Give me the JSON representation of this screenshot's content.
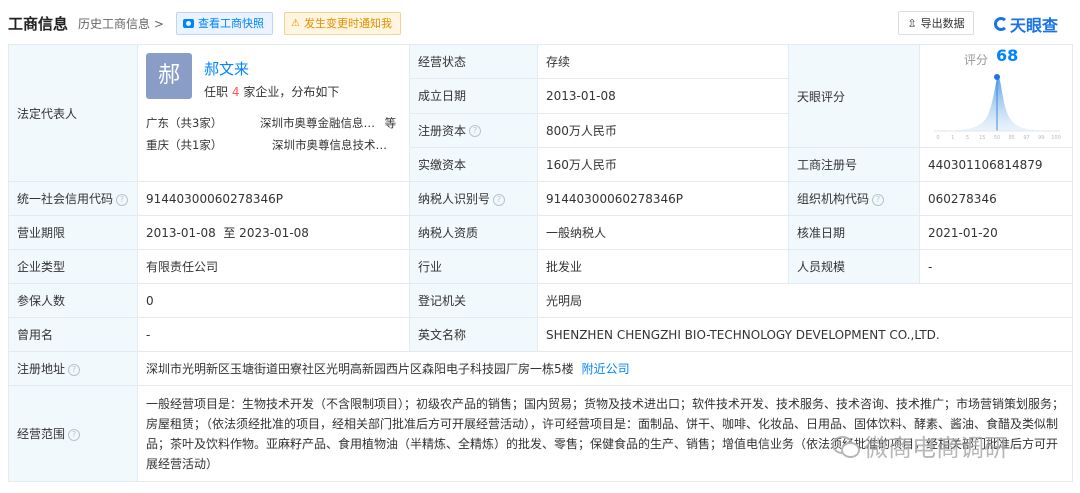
{
  "topbar": {
    "title": "工商信息",
    "history": "历史工商信息 >",
    "snapshot": "查看工商快照",
    "notify": "发生变更时通知我",
    "export": "导出数据",
    "brand": "天眼查"
  },
  "rep": {
    "label": "法定代表人",
    "avatar": "郝",
    "name": "郝文来",
    "sub_pre": "任职",
    "count": "4",
    "sub_post": "家企业，分布如下",
    "reg1_prov": "广东（共3家）",
    "reg1_co": "深圳市奥尊金融信息…",
    "reg1_more": "等",
    "reg2_prov": "重庆（共1家）",
    "reg2_co": "深圳市奥尊信息技术…"
  },
  "score": {
    "label": "天眼评分",
    "text": "评分",
    "value": "68",
    "ticks": [
      "0",
      "1",
      "5",
      "15",
      "50",
      "85",
      "97",
      "99",
      "100"
    ]
  },
  "rows": {
    "status_l": "经营状态",
    "status_v": "存续",
    "found_l": "成立日期",
    "found_v": "2013-01-08",
    "capital_l": "注册资本",
    "capital_v": "800万人民币",
    "paid_l": "实缴资本",
    "paid_v": "160万人民币",
    "regno_l": "工商注册号",
    "regno_v": "440301106814879",
    "credit_l": "统一社会信用代码",
    "credit_v": "91440300060278346P",
    "taxid_l": "纳税人识别号",
    "taxid_v": "91440300060278346P",
    "org_l": "组织机构代码",
    "org_v": "060278346",
    "term_l": "营业期限",
    "term_v": "2013-01-08  至 2023-01-08",
    "taxq_l": "纳税人资质",
    "taxq_v": "一般纳税人",
    "approve_l": "核准日期",
    "approve_v": "2021-01-20",
    "type_l": "企业类型",
    "type_v": "有限责任公司",
    "industry_l": "行业",
    "industry_v": "批发业",
    "staff_l": "人员规模",
    "staff_v": "-",
    "insured_l": "参保人数",
    "insured_v": "0",
    "authority_l": "登记机关",
    "authority_v": "光明局",
    "former_l": "曾用名",
    "former_v": "-",
    "english_l": "英文名称",
    "english_v": "SHENZHEN CHENGZHI BIO-TECHNOLOGY DEVELOPMENT CO.,LTD.",
    "addr_l": "注册地址",
    "addr_v": "深圳市光明新区玉塘街道田寮社区光明高新园西片区森阳电子科技园厂房一栋5楼",
    "addr_link": "附近公司",
    "scope_l": "经营范围",
    "scope_v": "一般经营项目是：生物技术开发（不含限制项目）；初级农产品的销售；国内贸易；货物及技术进出口；软件技术开发、技术服务、技术咨询、技术推广；市场营销策划服务；房屋租赁；（依法须经批准的项目，经相关部门批准后方可开展经营活动），许可经营项目是：面制品、饼干、咖啡、化妆品、日用品、固体饮料、酵素、酱油、食醋及类似制品；茶叶及饮料作物。亚麻籽产品、食用植物油（半精炼、全精炼）的批发、零售；保健食品的生产、销售；增值电信业务（依法须经批准的项目，经相关部门批准后方可开展经营活动）"
  },
  "watermark": "微商电商调研"
}
